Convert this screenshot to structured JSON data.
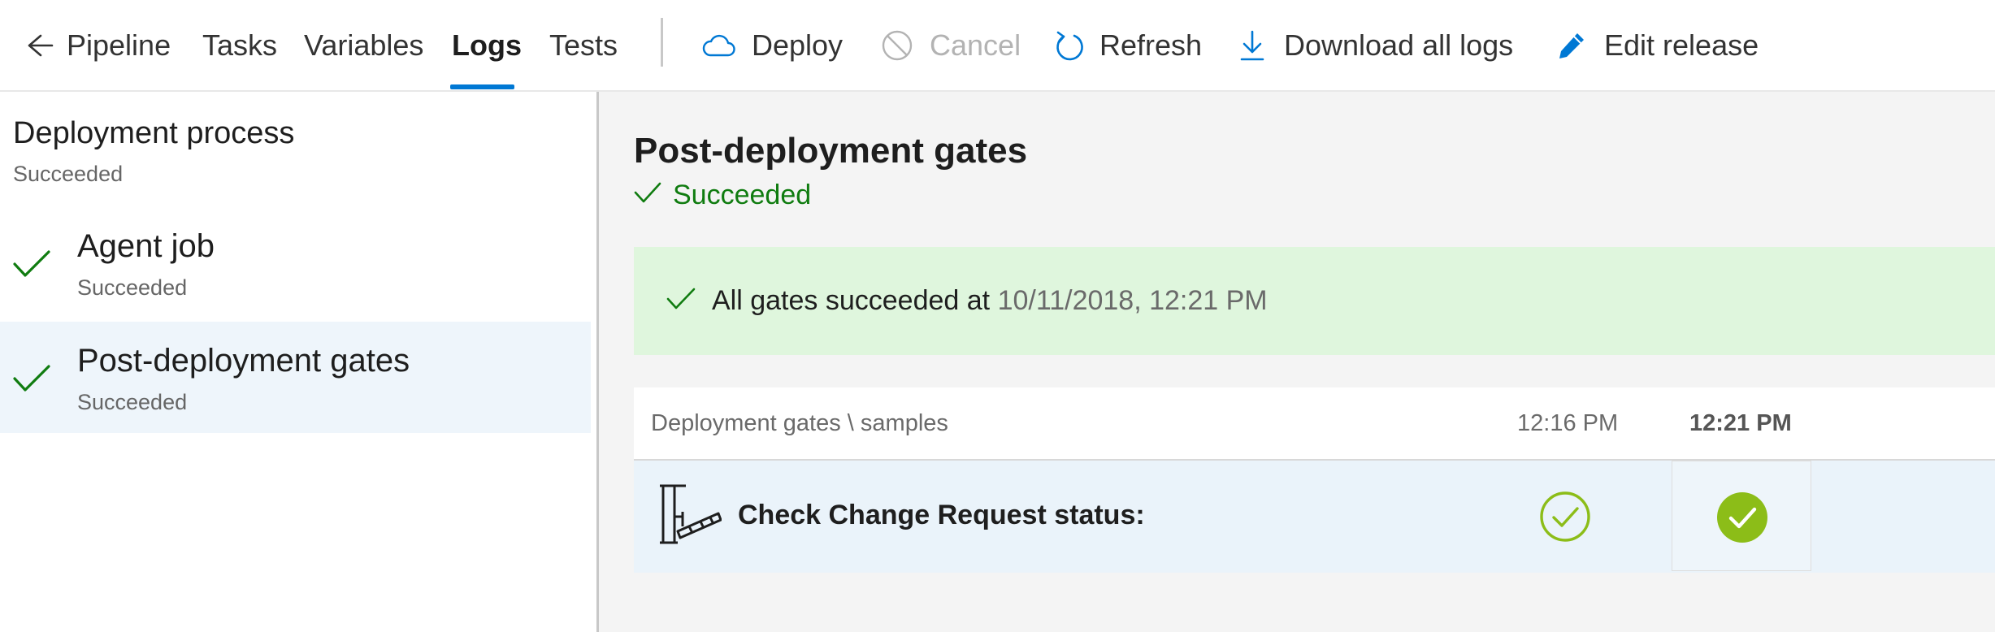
{
  "toolbar": {
    "back_label": "Pipeline",
    "tabs": [
      {
        "label": "Tasks"
      },
      {
        "label": "Variables"
      },
      {
        "label": "Logs",
        "active": true
      },
      {
        "label": "Tests"
      }
    ],
    "actions": {
      "deploy": "Deploy",
      "cancel": "Cancel",
      "refresh": "Refresh",
      "download": "Download all logs",
      "edit": "Edit release"
    }
  },
  "left_panel": {
    "title": "Deployment process",
    "subtitle": "Succeeded",
    "items": [
      {
        "name": "Agent job",
        "status": "Succeeded",
        "selected": false
      },
      {
        "name": "Post-deployment gates",
        "status": "Succeeded",
        "selected": true
      }
    ]
  },
  "main": {
    "title": "Post-deployment gates",
    "status": "Succeeded",
    "banner": {
      "text": "All gates succeeded at",
      "time": "10/11/2018, 12:21 PM"
    },
    "gates_table": {
      "path": "Deployment gates \\ samples",
      "columns": [
        "12:16 PM",
        "12:21 PM"
      ],
      "rows": [
        {
          "name": "Check Change Request status:",
          "results": [
            "succeeded",
            "succeeded"
          ]
        }
      ]
    }
  },
  "colors": {
    "accent": "#0078d4",
    "success": "#107c10",
    "gate_success": "#8cbd18",
    "banner_bg": "#dff6dd",
    "selected_bg": "#eef5fb"
  },
  "icons": {
    "back": "arrow-left-icon",
    "deploy": "cloud-icon",
    "cancel": "cancel-circle-icon",
    "refresh": "refresh-icon",
    "download": "download-icon",
    "edit": "pencil-icon",
    "status": "checkmark-icon",
    "gate": "gate-barrier-icon"
  }
}
